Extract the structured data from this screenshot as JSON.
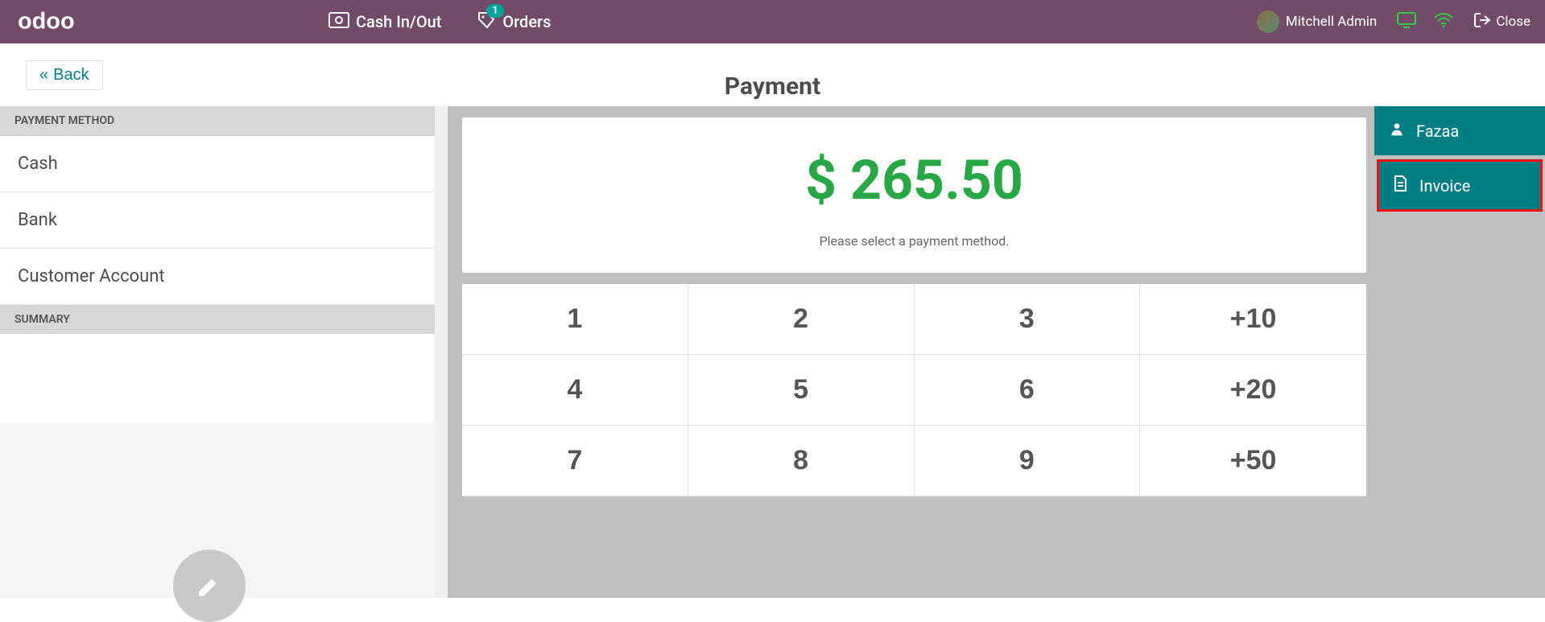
{
  "navbar": {
    "cash_in_out": "Cash In/Out",
    "orders": "Orders",
    "orders_badge": "1",
    "user_name": "Mitchell Admin",
    "close": "Close"
  },
  "subheader": {
    "back": "Back",
    "title": "Payment"
  },
  "left": {
    "payment_method_label": "PAYMENT METHOD",
    "methods": [
      "Cash",
      "Bank",
      "Customer Account"
    ],
    "summary_label": "SUMMARY"
  },
  "center": {
    "amount": "$ 265.50",
    "hint": "Please select a payment method.",
    "keys": [
      "1",
      "2",
      "3",
      "+10",
      "4",
      "5",
      "6",
      "+20",
      "7",
      "8",
      "9",
      "+50"
    ]
  },
  "right": {
    "customer": "Fazaa",
    "invoice": "Invoice"
  }
}
